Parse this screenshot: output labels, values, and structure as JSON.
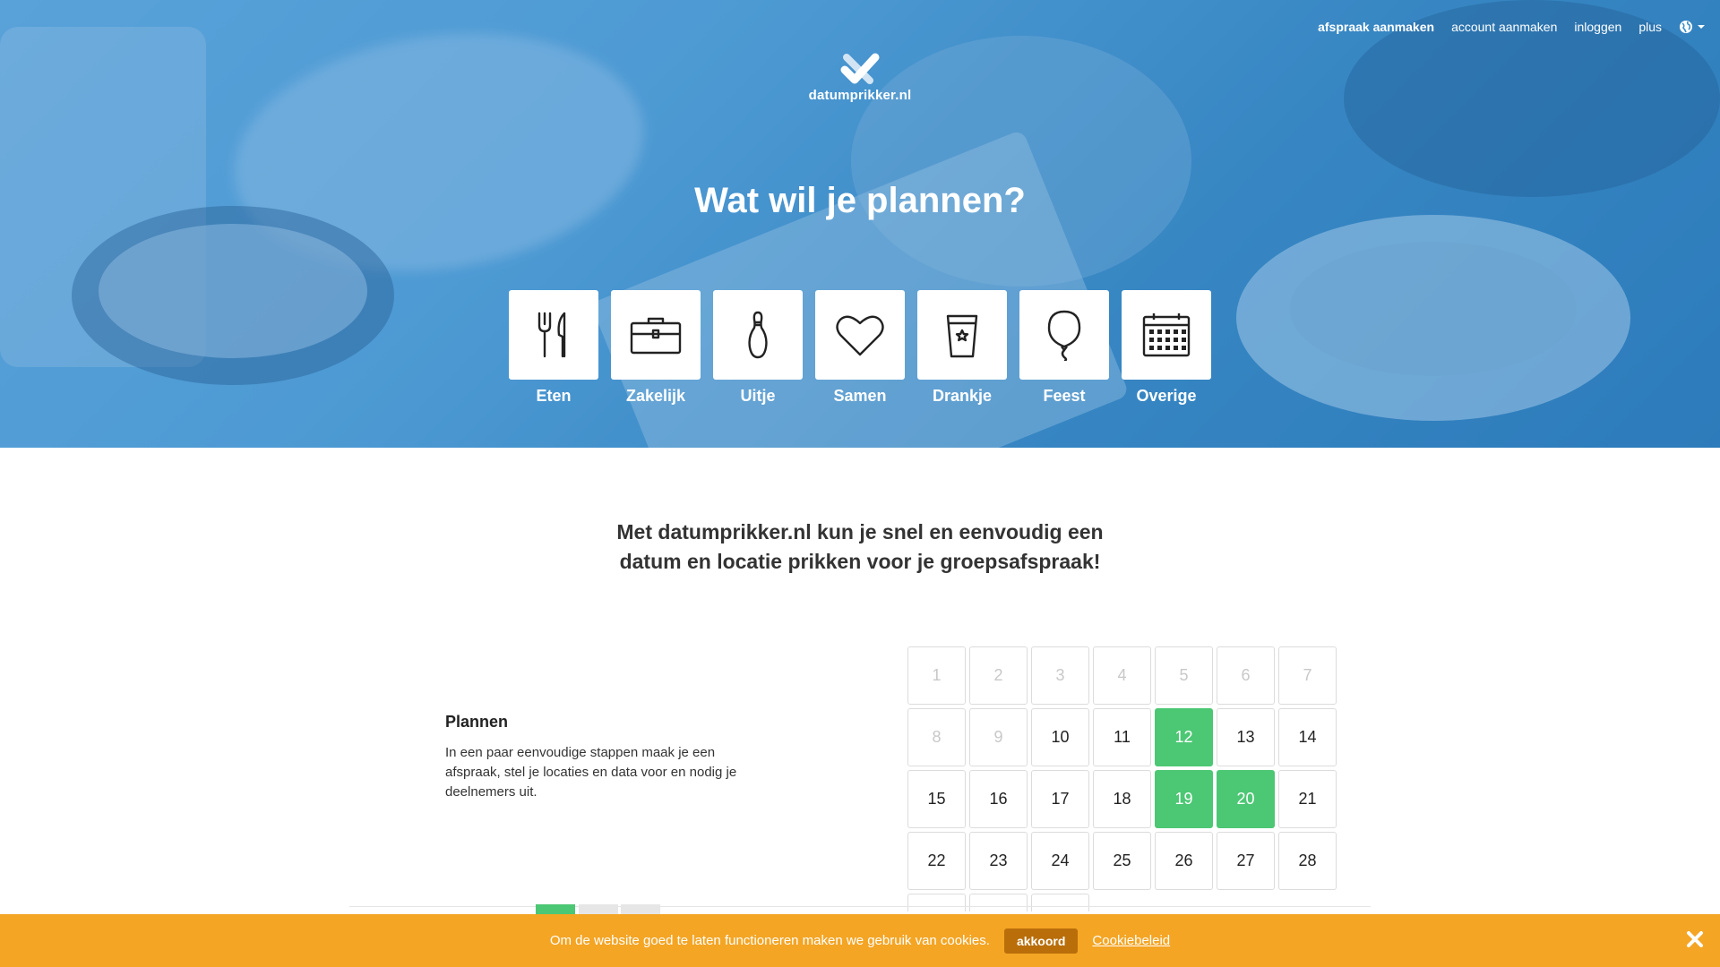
{
  "nav": {
    "items": [
      {
        "label": "afspraak aanmaken",
        "active": true
      },
      {
        "label": "account aanmaken",
        "active": false
      },
      {
        "label": "inloggen",
        "active": false
      },
      {
        "label": "plus",
        "active": false
      }
    ],
    "language_icon": "globe-icon"
  },
  "logo": {
    "text": "datumprikker.nl",
    "icon": "checkmark-logo-icon"
  },
  "hero": {
    "title": "Wat wil je plannen?",
    "categories": [
      {
        "label": "Eten",
        "icon": "fork-knife-icon"
      },
      {
        "label": "Zakelijk",
        "icon": "briefcase-icon"
      },
      {
        "label": "Uitje",
        "icon": "bowling-pin-icon"
      },
      {
        "label": "Samen",
        "icon": "heart-icon"
      },
      {
        "label": "Drankje",
        "icon": "cup-icon"
      },
      {
        "label": "Feest",
        "icon": "balloon-icon"
      },
      {
        "label": "Overige",
        "icon": "calendar-icon"
      }
    ]
  },
  "intro": {
    "line1": "Met datumprikker.nl kun je snel en eenvoudig een",
    "line2": "datum en locatie prikken voor je groepsafspraak!"
  },
  "feature": {
    "title": "Plannen",
    "text": "In een paar eenvoudige stappen maak je een afspraak, stel je locaties en data voor en nodig je deelnemers uit."
  },
  "calendar": {
    "days": [
      "1",
      "2",
      "3",
      "4",
      "5",
      "6",
      "7",
      "8",
      "9",
      "10",
      "11",
      "12",
      "13",
      "14",
      "15",
      "16",
      "17",
      "18",
      "19",
      "20",
      "21",
      "22",
      "23",
      "24",
      "25",
      "26",
      "27",
      "28"
    ],
    "muted": [
      "1",
      "2",
      "3",
      "4",
      "5",
      "6",
      "7",
      "8",
      "9"
    ],
    "selected": [
      "12",
      "19",
      "20"
    ],
    "selected_color": "#4cc774"
  },
  "cookie": {
    "message": "Om de website goed te laten functioneren maken we gebruik van cookies.",
    "accept_label": "akkoord",
    "policy_label": "Cookiebeleid",
    "close_icon": "close-icon",
    "bar_color": "#f4a524"
  }
}
